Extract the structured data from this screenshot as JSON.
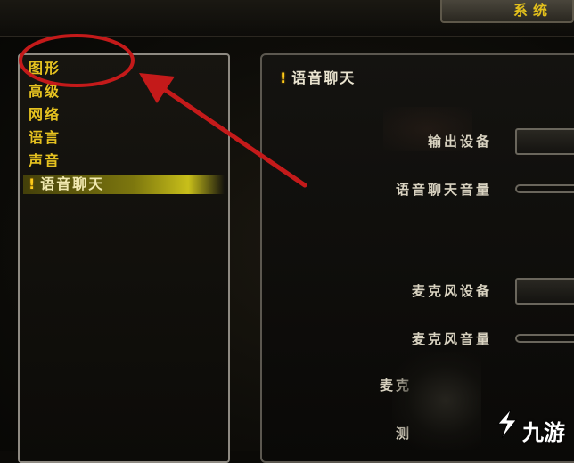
{
  "top_bar": {
    "tab_label": "系统"
  },
  "menu": {
    "items": [
      {
        "label": "图形",
        "selected": false
      },
      {
        "label": "高级",
        "selected": false
      },
      {
        "label": "网络",
        "selected": false
      },
      {
        "label": "语言",
        "selected": false
      },
      {
        "label": "声音",
        "selected": false
      },
      {
        "label": "语音聊天",
        "selected": true,
        "icon": "exclamation-icon"
      }
    ]
  },
  "panel": {
    "title": "语音聊天",
    "title_icon": "exclamation-icon",
    "rows": [
      {
        "label": "输出设备",
        "control": "dropdown"
      },
      {
        "label": "语音聊天音量",
        "control": "slider"
      },
      {
        "label": "麦克风设备",
        "control": "dropdown"
      },
      {
        "label": "麦克风音量",
        "control": "slider"
      },
      {
        "label": "麦克",
        "control": "none"
      },
      {
        "label": "测",
        "control": "none"
      }
    ]
  },
  "annotation": {
    "color": "#c41a1a",
    "shape": "circle-and-arrow"
  },
  "watermark": {
    "brand": "九游",
    "icon": "jiuyou-logo-icon"
  },
  "colors": {
    "menu_text": "#e6c220",
    "selected_bar": "#c8bf1a",
    "border": "#8e8a82"
  }
}
